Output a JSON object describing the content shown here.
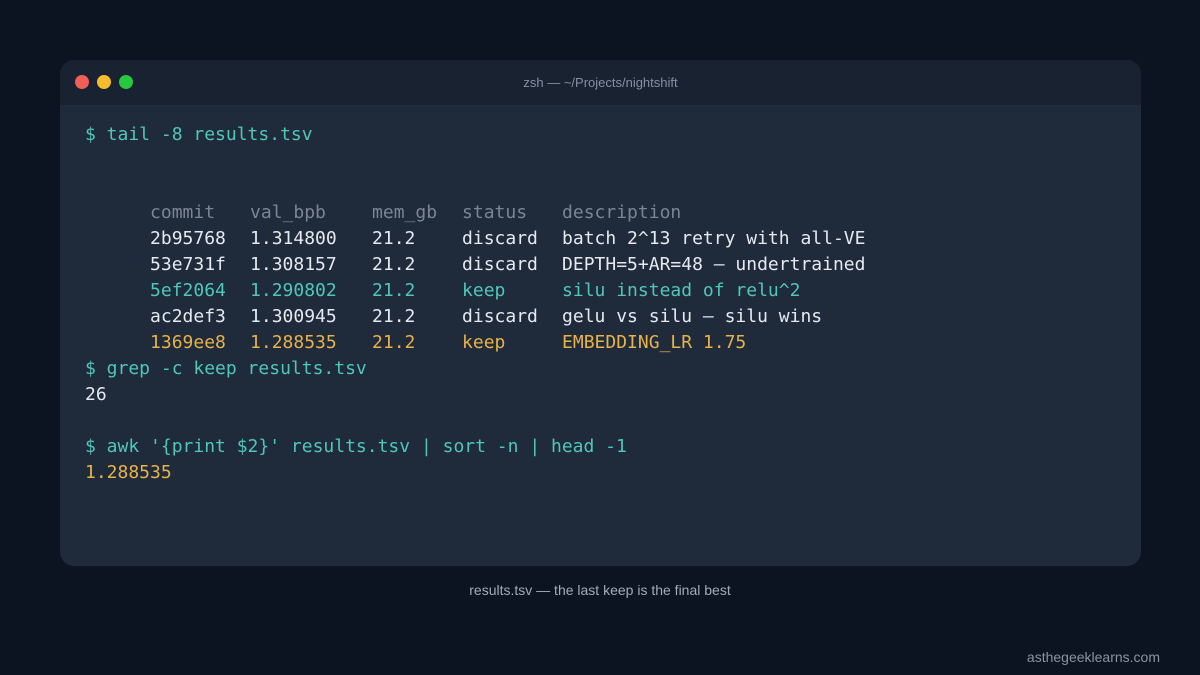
{
  "window": {
    "title": "zsh — ~/Projects/nightshift"
  },
  "terminal": {
    "cmd1": "$ tail -8 results.tsv",
    "columns": [
      "commit",
      "val_bpb",
      "mem_gb",
      "status",
      "description"
    ],
    "rows": [
      [
        "2b95768",
        "1.314800",
        "21.2",
        "discard",
        "batch 2^13 retry with all-VE"
      ],
      [
        "53e731f",
        "1.308157",
        "21.2",
        "discard",
        "DEPTH=5+AR=48 – undertrained"
      ],
      [
        "5ef2064",
        "1.290802",
        "21.2",
        "keep",
        "silu instead of relu^2"
      ],
      [
        "ac2def3",
        "1.300945",
        "21.2",
        "discard",
        "gelu vs silu – silu wins"
      ],
      [
        "1369ee8",
        "1.288535",
        "21.2",
        "keep",
        "EMBEDDING_LR 1.75"
      ]
    ],
    "cmd2": "$ grep -c keep results.tsv",
    "out2": "26",
    "cmd3": "$ awk '{print $2}' results.tsv | sort -n | head -1",
    "out3": "1.288535"
  },
  "caption": "results.tsv — the last keep is the final best",
  "watermark": "asthegeeklearns.com",
  "colors": {
    "background": "#0d1421",
    "window": "#1f2a3b",
    "titlebar": "#182231",
    "command": "#4fc8b4",
    "best": "#e8b24a",
    "header": "#7b8594"
  }
}
